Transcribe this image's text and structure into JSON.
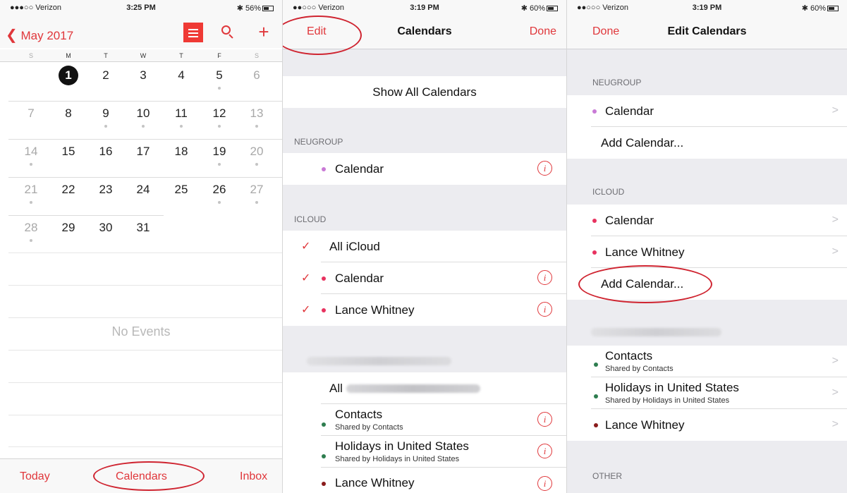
{
  "panel_month": {
    "status": {
      "carrier": "●●●○○ Verizon",
      "time": "3:25 PM",
      "battery": "56%"
    },
    "nav": {
      "back": "May 2017"
    },
    "weekdays": [
      "S",
      "M",
      "T",
      "W",
      "T",
      "F",
      "S"
    ],
    "weeks": [
      [
        {
          "d": ""
        },
        {
          "d": "1",
          "today": true
        },
        {
          "d": "2"
        },
        {
          "d": "3"
        },
        {
          "d": "4"
        },
        {
          "d": "5",
          "dot": true
        },
        {
          "d": "6"
        }
      ],
      [
        {
          "d": "7"
        },
        {
          "d": "8"
        },
        {
          "d": "9",
          "dot": true
        },
        {
          "d": "10",
          "dot": true
        },
        {
          "d": "11",
          "dot": true
        },
        {
          "d": "12",
          "dot": true
        },
        {
          "d": "13",
          "dot": true
        }
      ],
      [
        {
          "d": "14",
          "dot": true
        },
        {
          "d": "15"
        },
        {
          "d": "16"
        },
        {
          "d": "17"
        },
        {
          "d": "18"
        },
        {
          "d": "19",
          "dot": true
        },
        {
          "d": "20",
          "dot": true
        }
      ],
      [
        {
          "d": "21",
          "dot": true
        },
        {
          "d": "22"
        },
        {
          "d": "23"
        },
        {
          "d": "24"
        },
        {
          "d": "25"
        },
        {
          "d": "26",
          "dot": true
        },
        {
          "d": "27",
          "dot": true
        }
      ],
      [
        {
          "d": "28",
          "dot": true
        },
        {
          "d": "29"
        },
        {
          "d": "30"
        },
        {
          "d": "31"
        },
        {
          "d": ""
        },
        {
          "d": ""
        },
        {
          "d": ""
        }
      ]
    ],
    "no_events": "No Events",
    "tabs": {
      "today": "Today",
      "calendars": "Calendars",
      "inbox": "Inbox"
    }
  },
  "panel_calendars": {
    "status": {
      "carrier": "●●○○○ Verizon",
      "time": "3:19 PM",
      "battery": "60%"
    },
    "nav": {
      "edit": "Edit",
      "title": "Calendars",
      "done": "Done"
    },
    "show_all": "Show All Calendars",
    "sections": {
      "neugroup": "NEUGROUP",
      "icloud": "ICLOUD"
    },
    "neugroup_items": [
      {
        "label": "Calendar",
        "color": "#c97ad6"
      }
    ],
    "icloud_all": "All iCloud",
    "icloud_items": [
      {
        "label": "Calendar",
        "color": "#e8325f"
      },
      {
        "label": "Lance Whitney",
        "color": "#e8325f"
      }
    ],
    "account_all_prefix": "All",
    "account_items": [
      {
        "label": "Contacts",
        "sub": "Shared by Contacts",
        "color": "#2e7d4f"
      },
      {
        "label": "Holidays in United States",
        "sub": "Shared by Holidays in United States",
        "color": "#2e7d4f"
      },
      {
        "label": "Lance Whitney",
        "sub": "",
        "color": "#8a1c1c"
      }
    ]
  },
  "panel_edit": {
    "status": {
      "carrier": "●●○○○ Verizon",
      "time": "3:19 PM",
      "battery": "60%"
    },
    "nav": {
      "done": "Done",
      "title": "Edit Calendars"
    },
    "sections": {
      "neugroup": "NEUGROUP",
      "icloud": "ICLOUD",
      "other": "OTHER"
    },
    "neugroup_items": [
      {
        "label": "Calendar",
        "color": "#c97ad6"
      }
    ],
    "neugroup_add": "Add Calendar...",
    "icloud_items": [
      {
        "label": "Calendar",
        "color": "#e8325f"
      },
      {
        "label": "Lance Whitney",
        "color": "#e8325f"
      }
    ],
    "icloud_add": "Add Calendar...",
    "account_items": [
      {
        "label": "Contacts",
        "sub": "Shared by Contacts",
        "color": "#2e7d4f"
      },
      {
        "label": "Holidays in United States",
        "sub": "Shared by Holidays in United States",
        "color": "#2e7d4f"
      },
      {
        "label": "Lance Whitney",
        "sub": "",
        "color": "#8a1c1c"
      }
    ]
  },
  "colors": {
    "accent": "#e0373b",
    "annotation": "#cf2430"
  }
}
